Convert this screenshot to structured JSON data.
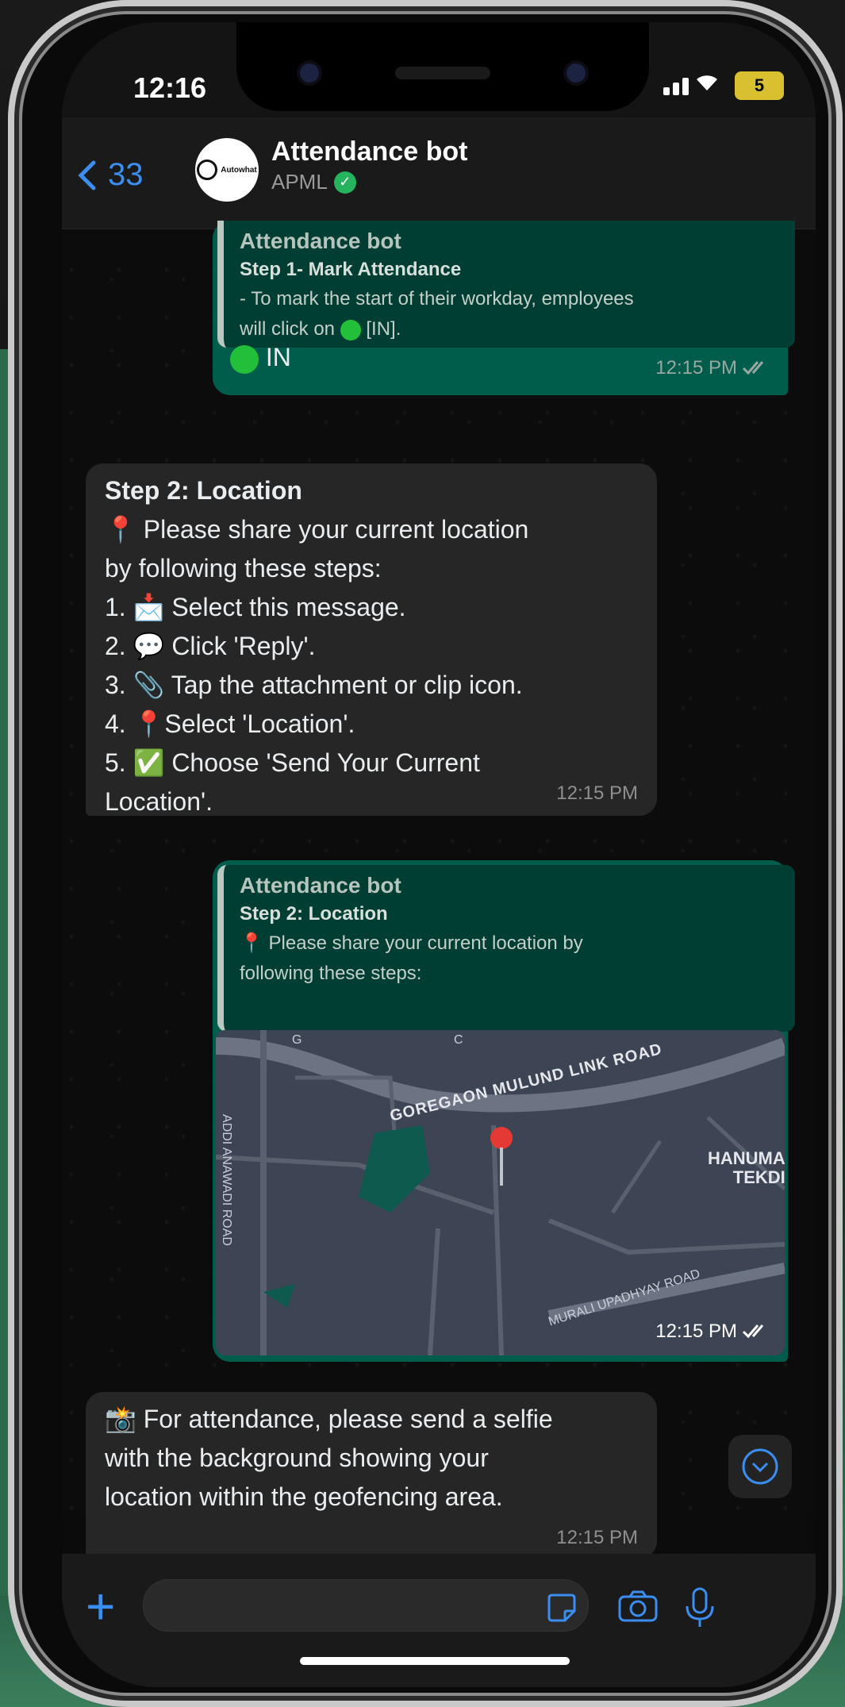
{
  "status": {
    "time": "12:16",
    "battery": "5"
  },
  "header": {
    "back_count": "33",
    "avatar_text": "Autowhat",
    "title": "Attendance bot",
    "subtitle": "APML"
  },
  "messages": {
    "m1": {
      "quote_title": "Attendance bot",
      "quote_step": "Step 1- Mark Attendance",
      "quote_body_1": " - To mark the start of their workday, employees",
      "quote_body_2": "will click on",
      "quote_body_3": "[IN].",
      "text": "IN",
      "time": "12:15 PM"
    },
    "m2": {
      "title": "Step 2: Location",
      "line1": "📍 Please share your current location",
      "line2": "by following these steps:",
      "line3": "1. 📩 Select this message.",
      "line4": "2. 💬 Click 'Reply'.",
      "line5": "3. 📎 Tap the attachment or clip icon.",
      "line6": "4. 📍Select 'Location'.",
      "line7": "5. ✅ Choose 'Send Your Current",
      "line8": "Location'.",
      "time": "12:15 PM"
    },
    "m3": {
      "quote_title": "Attendance bot",
      "quote_step": "Step 2: Location",
      "quote_body_1": "📍 Please share your current location by",
      "quote_body_2": "following these steps:",
      "map_labels": {
        "road1": "GOREGAON MULUND LINK ROAD",
        "area": "HANUMA",
        "area2": "TEKDI",
        "road2": "MURALI UPADHYAY ROAD",
        "road3": "ADDI ANAWADI ROAD",
        "g": "G",
        "c": "C"
      },
      "time": "12:15 PM"
    },
    "m4": {
      "line1": "📸 For attendance, please send a selfie",
      "line2": "with the background showing your",
      "line3": "location within the geofencing area.",
      "time": "12:15 PM"
    }
  },
  "colors": {
    "accent": "#3b8ef0",
    "outgoing": "#005c4b",
    "incoming": "#262626",
    "green_dot": "#22c03a"
  },
  "icons": [
    "back-chevron-icon",
    "verified-icon",
    "read-receipt-icon",
    "scroll-down-icon",
    "plus-icon",
    "sticker-icon",
    "camera-icon",
    "mic-icon",
    "map-pin-icon"
  ]
}
